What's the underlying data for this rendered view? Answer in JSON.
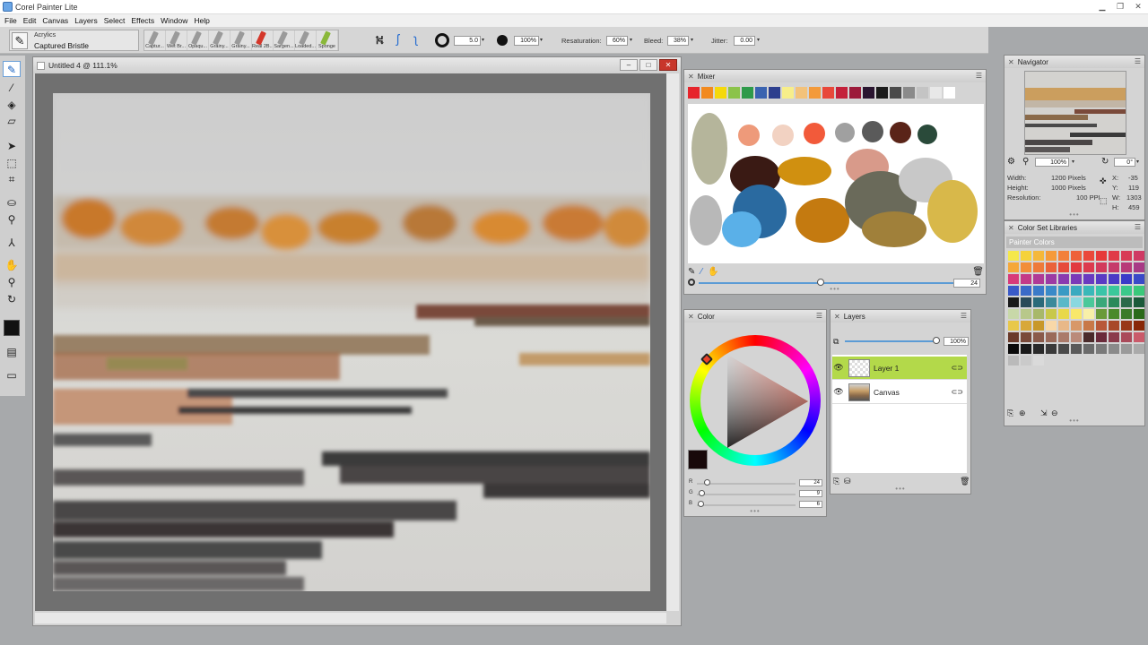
{
  "app": {
    "title": "Corel Painter Lite"
  },
  "menu": [
    "File",
    "Edit",
    "Canvas",
    "Layers",
    "Select",
    "Effects",
    "Window",
    "Help"
  ],
  "propbar": {
    "brush_category": "Acrylics",
    "brush_variant": "Captured Bristle",
    "recent_brushes": [
      "Captur...",
      "Wet Br...",
      "Opaqu...",
      "Grainy...",
      "Grainy...",
      "Real 2B...",
      "Sargen...",
      "Loaded...",
      "Sponge"
    ],
    "size_value": "5.0",
    "opacity_value": "100%",
    "resaturation_label": "Resaturation:",
    "resaturation_value": "60%",
    "bleed_label": "Bleed:",
    "bleed_value": "38%",
    "jitter_label": "Jitter:",
    "jitter_value": "0.00"
  },
  "document": {
    "title": "Untitled 4 @ 111.1%"
  },
  "mixer": {
    "title": "Mixer",
    "swatches": [
      "#e6242b",
      "#f28a1f",
      "#f5d90b",
      "#8bc34a",
      "#2e9a4a",
      "#3a63b0",
      "#2d3f8e",
      "#f7ee8a",
      "#f3c27a",
      "#f39a3a",
      "#e8483a",
      "#c4203a",
      "#9c1a3a",
      "#2a1530",
      "#1a1a1a",
      "#4a4a4a",
      "#8a8a8a",
      "#c4c4c4",
      "#e8e8e8",
      "#ffffff"
    ],
    "slider_value": "24"
  },
  "navigator": {
    "title": "Navigator",
    "zoom": "100%",
    "rotation": "0°",
    "width_label": "Width:",
    "width_value": "1200 Pixels",
    "height_label": "Height:",
    "height_value": "1000 Pixels",
    "resolution_label": "Resolution:",
    "resolution_value": "100 PPI",
    "x_label": "X:",
    "x_value": "-35",
    "y_label": "Y:",
    "y_value": "119",
    "w_label": "W:",
    "w_value": "1303",
    "h_label": "H:",
    "h_value": "459"
  },
  "colorlib": {
    "title": "Color Set Libraries",
    "set_name": "Painter Colors",
    "colors": [
      "#f5e84a",
      "#f5d23a",
      "#f5b83a",
      "#f59a3a",
      "#f2803a",
      "#ee623a",
      "#ea483a",
      "#e63a3a",
      "#e03a48",
      "#d83a56",
      "#cf3a64",
      "#f5a83a",
      "#f28e3a",
      "#ee7a3a",
      "#ea623a",
      "#e64a3a",
      "#e23a40",
      "#dc3a4e",
      "#d23a5c",
      "#c63a6a",
      "#b83a78",
      "#a83a86",
      "#d83a7a",
      "#c43a88",
      "#b03a96",
      "#9c3aa4",
      "#8a3ab0",
      "#7a3ab8",
      "#6a3ac0",
      "#5a3ac4",
      "#4a3ac6",
      "#3a3ac8",
      "#3a4ac8",
      "#3a5ac8",
      "#3a6ac8",
      "#3a7ac8",
      "#3a8ac8",
      "#3a9ac4",
      "#3aaac0",
      "#3ab8b8",
      "#3ac4a8",
      "#3ac89a",
      "#3ac88a",
      "#3ac87a",
      "#1a1a1a",
      "#2a4a5a",
      "#2a6a7a",
      "#3a8a9a",
      "#5ab8c8",
      "#8ad8e0",
      "#4ac89a",
      "#3aa87a",
      "#2a8a5a",
      "#2a6a4a",
      "#1a5a3a",
      "#c8d8a8",
      "#b8c88a",
      "#a8b86a",
      "#c8c84a",
      "#e8d84a",
      "#f8e86a",
      "#f8f0a8",
      "#6a9a3a",
      "#4a8a2a",
      "#3a7a2a",
      "#2a6a1a",
      "#e8c84a",
      "#d8a83a",
      "#c8982a",
      "#f8d8a8",
      "#e8b888",
      "#d89868",
      "#c87848",
      "#b85838",
      "#a84828",
      "#983818",
      "#882808",
      "#6a3a2a",
      "#7a4a3a",
      "#8a5a4a",
      "#9a6a5a",
      "#aa7a6a",
      "#ba8a7a",
      "#4a2a2a",
      "#6a2a3a",
      "#8a3a4a",
      "#aa4a5a",
      "#ca5a6a",
      "#0a0a0a",
      "#1a1a1a",
      "#2a2a2a",
      "#3a3a3a",
      "#4a4a4a",
      "#5a5a5a",
      "#6a6a6a",
      "#7a7a7a",
      "#8a8a8a",
      "#9a9a9a",
      "#aaaaaa",
      "#bababa",
      "#cacaca",
      "#dadada"
    ]
  },
  "colorpanel": {
    "title": "Color",
    "r_label": "R",
    "r_value": "24",
    "g_label": "G",
    "g_value": "9",
    "b_label": "B",
    "b_value": "6",
    "swatch": "#18090a"
  },
  "layerspanel": {
    "title": "Layers",
    "opacity": "100%",
    "layers": [
      {
        "name": "Layer 1"
      },
      {
        "name": "Canvas"
      }
    ]
  }
}
